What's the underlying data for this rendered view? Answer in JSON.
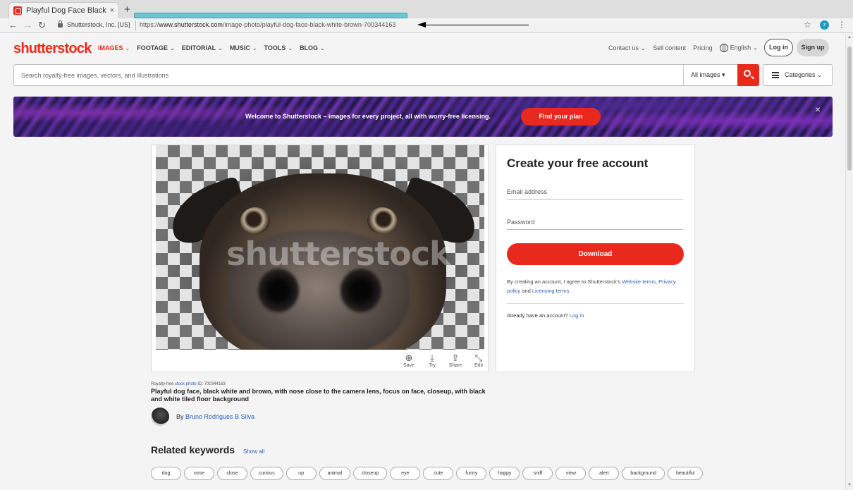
{
  "browser": {
    "tab_title": "Playful Dog Face Black Wh",
    "tab_close": "×",
    "new_tab": "+",
    "site_identity": "Shutterstock, Inc. [US]",
    "url_prefix": "https://",
    "url_domain": "www.shutterstock.com",
    "url_path": "/image-photo/playful-dog-face-black-white-brown-700344163",
    "profile_initial": "z"
  },
  "header": {
    "logo": "shutterstock",
    "nav": [
      {
        "label": "IMAGES"
      },
      {
        "label": "FOOTAGE"
      },
      {
        "label": "EDITORIAL"
      },
      {
        "label": "MUSIC"
      },
      {
        "label": "TOOLS"
      },
      {
        "label": "BLOG"
      }
    ],
    "contact": "Contact us",
    "sell": "Sell content",
    "pricing": "Pricing",
    "language": "English",
    "login": "Log in",
    "signup": "Sign up"
  },
  "search": {
    "placeholder": "Search royalty-free images, vectors, and illustrations",
    "type": "All images",
    "categories": "Categories"
  },
  "banner": {
    "text": "Welcome to Shutterstock – images for every project, all with worry-free licensing.",
    "cta": "Find your plan",
    "close": "×"
  },
  "image": {
    "watermark": "shutterstock",
    "actions": [
      {
        "icon": "⊕",
        "label": "Save"
      },
      {
        "icon": "⤓",
        "label": "Try"
      },
      {
        "icon": "⇪",
        "label": "Share"
      },
      {
        "icon": "⤡",
        "label": "Edit"
      }
    ],
    "meta_prefix": "Royalty-free ",
    "meta_link": "stock photo",
    "meta_id": " ID: 700344163",
    "title": "Playful dog face, black white and brown, with nose close to the camera lens, focus on face, closeup, with black and white tiled floor background",
    "author_prefix": "By ",
    "author_name": "Bruno Rodrigues B Silva"
  },
  "signup": {
    "title": "Create your free account",
    "email_placeholder": "Email address",
    "password_placeholder": "Password",
    "download": "Download",
    "terms_1": "By creating an account, I agree to Shutterstock's ",
    "terms_link_1": "Website terms",
    "terms_link_2": "Privacy policy",
    "terms_and": " and ",
    "terms_link_3": "Licensing terms",
    "already": "Already have an account? ",
    "login_link": "Log in"
  },
  "related": {
    "heading": "Related keywords",
    "show_all": "Show all",
    "keywords": [
      "dog",
      "nose",
      "close",
      "curious",
      "up",
      "animal",
      "closeup",
      "eye",
      "cute",
      "funny",
      "happy",
      "sniff",
      "view",
      "alert",
      "background",
      "beautiful"
    ]
  },
  "colors": {
    "brand_red": "#e8291c",
    "link_blue": "#2a5fb8",
    "url_highlight": "#69c8cf"
  }
}
